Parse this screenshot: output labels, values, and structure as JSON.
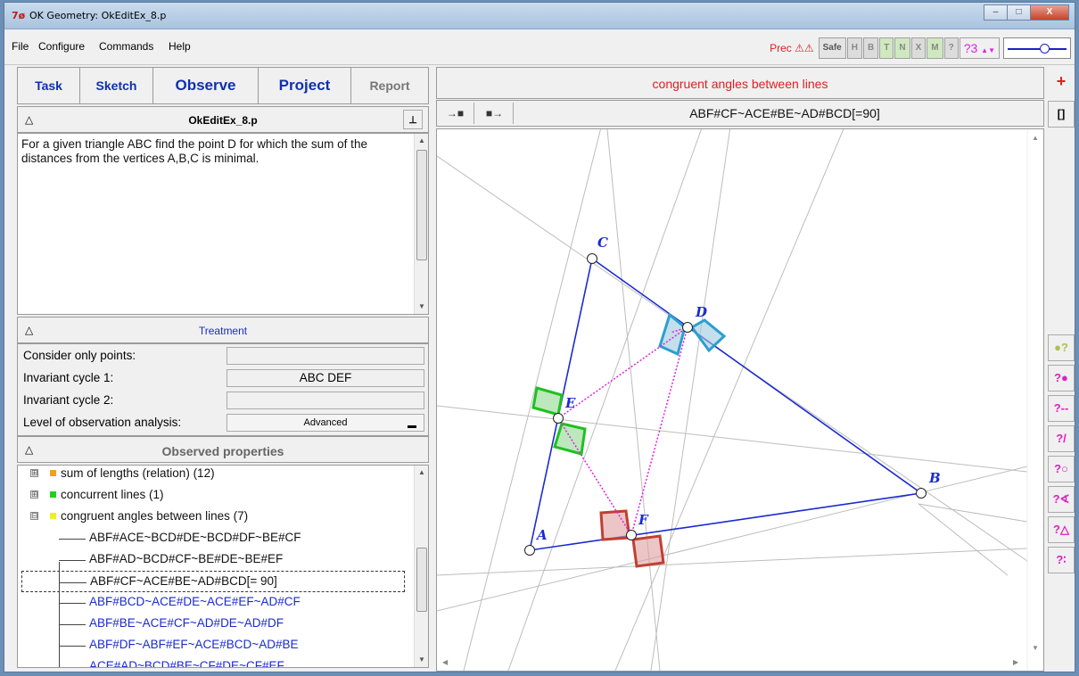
{
  "window": {
    "title": "OK Geometry: OkEditEx_8.p",
    "app_icon": "7ø",
    "buttons": [
      "–",
      "□",
      "X"
    ]
  },
  "menu": [
    "File",
    "Configure",
    "Commands",
    "Help"
  ],
  "toolbar": {
    "prec_label": "Prec ⚠⚠",
    "buttons": [
      "Safe",
      "H",
      "B",
      "T",
      "N",
      "X",
      "M",
      "?"
    ],
    "q3": "?3"
  },
  "tabs": [
    "Task",
    "Sketch",
    "Observe",
    "Project",
    "Report"
  ],
  "task": {
    "filename": "OkEditEx_8.p",
    "pin_icon": "⊥",
    "collapse_icon": "△",
    "text": "For a given triangle ABC find the point D for which the sum of the distances from the vertices A,B,C is minimal."
  },
  "treatment": {
    "header": "Treatment",
    "rows": [
      {
        "label": "Consider only points:",
        "value": ""
      },
      {
        "label": "Invariant cycle 1:",
        "value": "ABC DEF"
      },
      {
        "label": "Invariant cycle 2:",
        "value": ""
      },
      {
        "label": "Level of observation analysis:",
        "value": "Advanced"
      }
    ]
  },
  "observed": {
    "header": "Observed properties",
    "groups": [
      {
        "label": "sum of lengths (relation) (12)",
        "color": "#f0a020",
        "expander": "⊞"
      },
      {
        "label": "concurrent lines (1)",
        "color": "#20d020",
        "expander": "⊞"
      },
      {
        "label": "congruent angles between lines (7)",
        "color": "#f0f020",
        "expander": "⊟"
      }
    ],
    "items": [
      {
        "text": "ABF#ACE~BCD#DE~BCD#DF~BE#CF",
        "blue": false
      },
      {
        "text": "ABF#AD~BCD#CF~BE#DE~BE#EF",
        "blue": false
      },
      {
        "text": "ABF#CF~ACE#BE~AD#BCD[= 90]",
        "blue": false,
        "selected": true
      },
      {
        "text": "ABF#BCD~ACE#DE~ACE#EF~AD#CF",
        "blue": true
      },
      {
        "text": "ABF#BE~ACE#CF~AD#DE~AD#DF",
        "blue": true
      },
      {
        "text": "ABF#DF~ABF#EF~ACE#BCD~AD#BE",
        "blue": true
      },
      {
        "text": "ACE#AD~BCD#BE~CF#DE~CF#EF",
        "blue": true
      }
    ]
  },
  "canvas": {
    "caption": "congruent angles between lines",
    "nav_back": "→■",
    "nav_fwd": "■→",
    "formula": "ABF#CF~ACE#BE~AD#BCD[=90]",
    "points": [
      "A",
      "B",
      "C",
      "D",
      "E",
      "F"
    ]
  },
  "side_tools": [
    "+",
    "[]",
    "●?",
    "?●",
    "?--",
    "?/",
    "?○",
    "?∢",
    "?△",
    "?∶"
  ],
  "colors": {
    "accent_red": "#e02020",
    "tab_blue": "#1030b0",
    "magenta": "#e020e0",
    "line_blue": "#1a2ad0"
  }
}
